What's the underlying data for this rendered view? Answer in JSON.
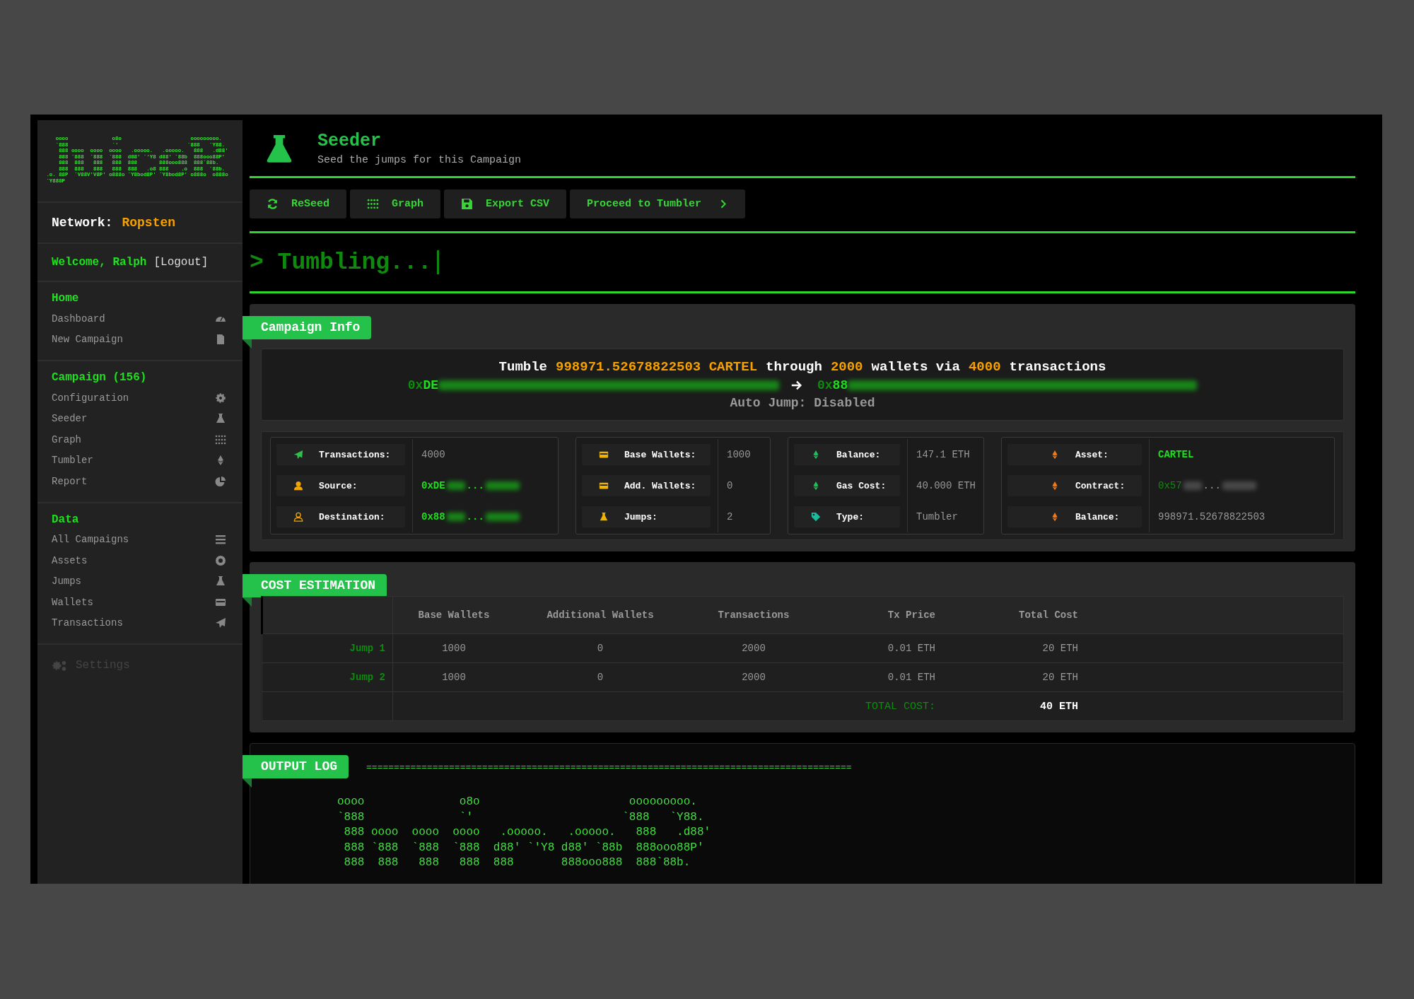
{
  "logo_art": [
    "    oooo              o8o                      ooooooooo.",
    "    `888              `'                      `888   `Y88.",
    "     888 oooo  oooo  oooo   .ooooo.   .ooooo.   888   .d88'",
    "     888 `888  `888  `888  d88' `'Y8 d88' `88b  888ooo88P'",
    "     888  888   888   888  888       888ooo888  888`88b.",
    "     888  888   888   888  888   .o8 888    .o  888  `88b.",
    " .o. 88P  `V88V'V8P' o888o `Y8bod8P' `Y8bod8P' o888o  o888o",
    " `Y888P"
  ],
  "network": {
    "label": "Network:",
    "value": "Ropsten"
  },
  "user": {
    "welcome": "Welcome, Ralph",
    "logout": "[Logout]"
  },
  "nav": [
    {
      "heading": "Home",
      "items": [
        {
          "label": "Dashboard",
          "kind": "gauge"
        },
        {
          "label": "New Campaign",
          "kind": "file"
        }
      ]
    },
    {
      "heading": "Campaign (156)",
      "items": [
        {
          "label": "Configuration",
          "kind": "gear"
        },
        {
          "label": "Seeder",
          "kind": "flask"
        },
        {
          "label": "Graph",
          "kind": "dots"
        },
        {
          "label": "Tumbler",
          "kind": "eth"
        },
        {
          "label": "Report",
          "kind": "pie"
        }
      ]
    },
    {
      "heading": "Data",
      "items": [
        {
          "label": "All Campaigns",
          "kind": "list"
        },
        {
          "label": "Assets",
          "kind": "coin"
        },
        {
          "label": "Jumps",
          "kind": "flask"
        },
        {
          "label": "Wallets",
          "kind": "card"
        },
        {
          "label": "Transactions",
          "kind": "plane"
        }
      ]
    }
  ],
  "settings": {
    "label": "Settings",
    "disabled": true
  },
  "page": {
    "title": "Seeder",
    "subtitle": "Seed the jumps for this Campaign"
  },
  "toolbar": [
    {
      "label": "ReSeed",
      "kind": "refresh"
    },
    {
      "label": "Graph",
      "kind": "dots"
    },
    {
      "label": "Export CSV",
      "kind": "save"
    },
    {
      "label": "Proceed to Tumbler",
      "kind": "chevron"
    }
  ],
  "status_line": {
    "prompt": ">",
    "text": "Tumbling..."
  },
  "campaign_info": {
    "title": "Campaign Info",
    "summary": [
      {
        "text": "Tumble",
        "highlight": false
      },
      {
        "text": "998971.52678822503 CARTEL",
        "highlight": true
      },
      {
        "text": "through",
        "highlight": false
      },
      {
        "text": "2000",
        "highlight": true
      },
      {
        "text": "wallets via",
        "highlight": false
      },
      {
        "text": "4000",
        "highlight": true
      },
      {
        "text": "transactions",
        "highlight": false
      }
    ],
    "from": {
      "dim": "0x",
      "bright": "DE"
    },
    "to": {
      "dim": "0x",
      "bright": "88"
    },
    "auto_jump": "Auto Jump: Disabled",
    "stat_groups": [
      [
        {
          "label": "Transactions:",
          "kind": "plane",
          "value": {
            "kind": "plain",
            "text": "4000"
          }
        },
        {
          "label": "Source:",
          "kind": "user",
          "value": {
            "kind": "masked",
            "text": "0xDE",
            "sep": "..."
          }
        },
        {
          "label": "Destination:",
          "kind": "user-outline",
          "value": {
            "kind": "masked",
            "text": "0x88",
            "sep": "..."
          }
        }
      ],
      [
        {
          "label": "Base Wallets:",
          "kind": "card",
          "value": {
            "kind": "plain",
            "text": "1000"
          }
        },
        {
          "label": "Add. Wallets:",
          "kind": "card",
          "value": {
            "kind": "plain",
            "text": "0"
          }
        },
        {
          "label": "Jumps:",
          "kind": "flask",
          "value": {
            "kind": "plain",
            "text": "2"
          }
        }
      ],
      [
        {
          "label": "Balance:",
          "kind": "eth",
          "value": {
            "kind": "plain",
            "text": "147.1 ETH"
          }
        },
        {
          "label": "Gas Cost:",
          "kind": "eth",
          "value": {
            "kind": "plain",
            "text": "40.000 ETH"
          }
        },
        {
          "label": "Type:",
          "kind": "tag",
          "value": {
            "kind": "plain",
            "text": "Tumbler"
          }
        }
      ],
      [
        {
          "label": "Asset:",
          "kind": "eth-orange",
          "value": {
            "kind": "green",
            "text": "CARTEL"
          }
        },
        {
          "label": "Contract:",
          "kind": "eth-orange",
          "value": {
            "kind": "masked-dim",
            "text": "0x57",
            "sep": "..."
          }
        },
        {
          "label": "Balance:",
          "kind": "eth-orange",
          "value": {
            "kind": "plain",
            "text": "998971.52678822503"
          }
        }
      ]
    ]
  },
  "cost_estimation": {
    "title": "COST ESTIMATION",
    "columns": [
      "Base Wallets",
      "Additional Wallets",
      "Transactions",
      "Tx Price",
      "Total Cost"
    ],
    "rows": [
      {
        "label": "Jump 1",
        "cells": [
          "1000",
          "0",
          "2000",
          "0.01 ETH",
          "20 ETH"
        ]
      },
      {
        "label": "Jump 2",
        "cells": [
          "1000",
          "0",
          "2000",
          "0.01 ETH",
          "20 ETH"
        ]
      }
    ],
    "total": {
      "label": "TOTAL COST:",
      "value": "40 ETH"
    }
  },
  "output_log": {
    "title": "OUTPUT LOG",
    "rule": "========================================================================================",
    "lines": [
      "oooo              o8o                      ooooooooo.",
      "`888              `'                      `888   `Y88.",
      " 888 oooo  oooo  oooo   .ooooo.   .ooooo.   888   .d88'",
      " 888 `888  `888  `888  d88' `'Y8 d88' `88b  888ooo88P'",
      " 888  888   888   888  888       888ooo888  888`88b."
    ]
  }
}
